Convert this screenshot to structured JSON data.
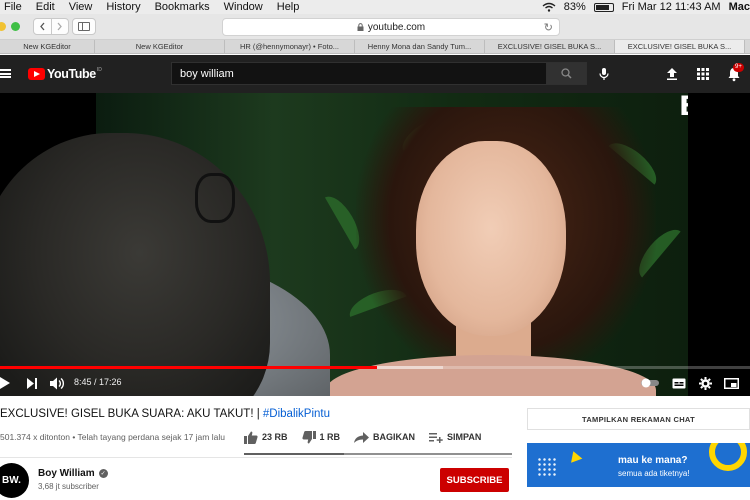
{
  "menubar": {
    "items": [
      "File",
      "Edit",
      "View",
      "History",
      "Bookmarks",
      "Window",
      "Help"
    ],
    "battery": "83%",
    "datetime": "Fri Mar 12  11:43 AM",
    "user": "Mac"
  },
  "browser": {
    "url": "youtube.com",
    "tabs": [
      {
        "label": "New KGEditor",
        "active": false
      },
      {
        "label": "New KGEditor",
        "active": false
      },
      {
        "label": "HR (@hennymonayr) • Foto...",
        "active": false
      },
      {
        "label": "Henny Mona dan Sandy Tum...",
        "active": false
      },
      {
        "label": "EXCLUSIVE! GISEL BUKA S...",
        "active": false
      },
      {
        "label": "EXCLUSIVE! GISEL BUKA S...",
        "active": true
      }
    ]
  },
  "youtube": {
    "logo_text": "YouTube",
    "logo_region": "ID",
    "search_value": "boy william",
    "notification_count": "9+"
  },
  "video": {
    "watermark": "BW.",
    "current_time": "8:45",
    "duration": "17:26",
    "time_display": "8:45 / 17:26",
    "progress_fraction": 0.502,
    "buffered_fraction": 0.59,
    "title_main": "EXCLUSIVE! GISEL BUKA SUARA: AKU TAKUT! | ",
    "title_tag": "#DibalikPintu",
    "views": "501.374 x ditonton",
    "premiered": "Telah tayang perdana sejak 17 jam lalu",
    "meta_separator": " • ",
    "likes": "23 RB",
    "dislikes": "1 RB",
    "share_label": "BAGIKAN",
    "save_label": "SIMPAN"
  },
  "channel": {
    "name": "Boy William",
    "subscribers": "3,68 jt subscriber",
    "avatar_text": "BW.",
    "subscribe_label": "SUBSCRIBE"
  },
  "sidebar": {
    "chat_replay_label": "TAMPILKAN REKAMAN CHAT",
    "ad_line1": "mau ke mana?",
    "ad_line2": "semua ada tiketnya!"
  },
  "colors": {
    "yt_red": "#ff0000",
    "subscribe_red": "#cc0000",
    "hashtag_blue": "#065fd4",
    "ad_blue": "#1e6fd0",
    "ad_yellow": "#ffd600"
  }
}
